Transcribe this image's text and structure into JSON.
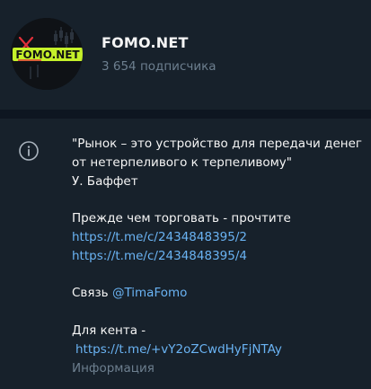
{
  "channel": {
    "title": "FOMO.NET",
    "subscribers": "3 654 подписчика",
    "avatar_logo_text": "FOMO.NET"
  },
  "info": {
    "icon": "info-icon",
    "quote_line1": "\"Рынок – это устройство для передачи денег",
    "quote_line2": "от нетерпеливого к терпеливому\"",
    "author": "У. Баффет",
    "read_text": "Прежде чем торговать - прочтите",
    "link1": "https://t.me/c/2434848395/2",
    "link2": "https://t.me/c/2434848395/4",
    "contact_label": "Связь",
    "contact_handle": "@TimaFomo",
    "kent_label": "Для кента -",
    "invite_link": "https://t.me/+vY2oZCwdHyFjNTAy",
    "caption": "Информация"
  },
  "colors": {
    "background": "#17212b",
    "divider": "#0e1621",
    "link": "#6ab3f3",
    "secondary_text": "#6d7f8f",
    "logo_green": "#c5f02a",
    "logo_red": "#e0303a"
  }
}
